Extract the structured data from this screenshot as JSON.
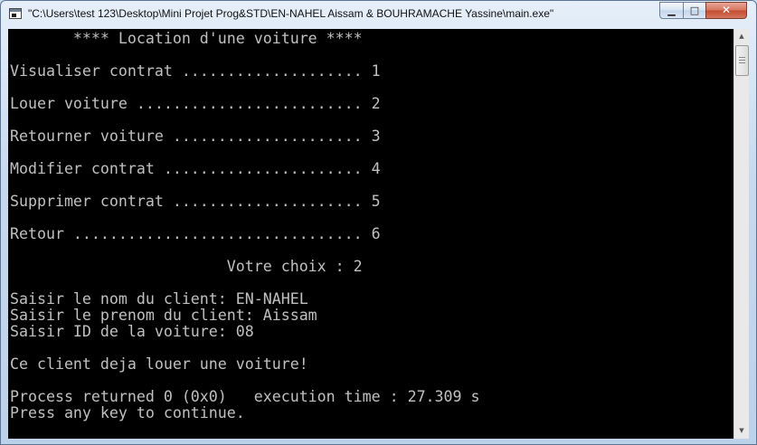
{
  "window": {
    "title": "\"C:\\Users\\test 123\\Desktop\\Mini Projet Prog&STD\\EN-NAHEL Aissam & BOUHRAMACHE Yassine\\main.exe\"",
    "icon": "console-app-icon",
    "controls": {
      "minimize": "▁",
      "maximize": "□",
      "close": "✕"
    }
  },
  "console": {
    "text_color": "#c0c0c0",
    "background": "#000000",
    "lines": [
      "       **** Location d'une voiture ****",
      "Visualiser contrat .................... 1",
      "Louer voiture ......................... 2",
      "Retourner voiture ..................... 3",
      "Modifier contrat ...................... 4",
      "Supprimer contrat ..................... 5",
      "Retour ................................ 6",
      "                        Votre choix : 2",
      "Saisir le nom du client: EN-NAHEL",
      "Saisir le prenom du client: Aissam",
      "Saisir ID de la voiture: 08",
      "Ce client deja louer une voiture!",
      "Process returned 0 (0x0)   execution time : 27.309 s",
      "Press any key to continue."
    ]
  },
  "scrollbar": {
    "up_arrow": "▲",
    "down_arrow": "▼"
  }
}
